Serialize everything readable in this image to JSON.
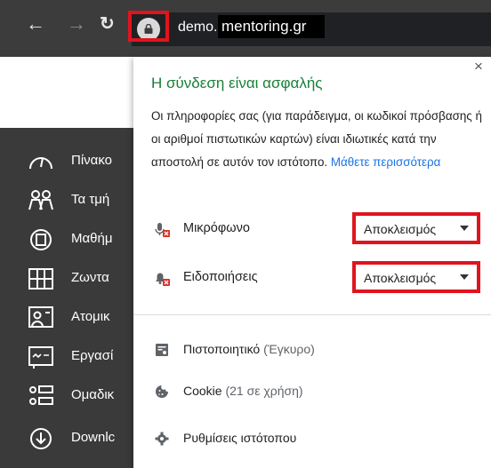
{
  "browser": {
    "url_prefix": "demo.",
    "url_domain": "mentoring.gr",
    "icons": {
      "back": "arrow-left-icon",
      "forward": "arrow-right-icon",
      "reload": "reload-icon",
      "lock": "lock-icon"
    }
  },
  "sidebar": {
    "items": [
      {
        "label": "Πίνακο",
        "icon": "dashboard-icon"
      },
      {
        "label": "Τα τμή",
        "icon": "people-icon"
      },
      {
        "label": "Μαθήμ",
        "icon": "lesson-icon"
      },
      {
        "label": "Ζωντα",
        "icon": "grid-icon"
      },
      {
        "label": "Ατομικ",
        "icon": "person-board-icon"
      },
      {
        "label": "Εργασί",
        "icon": "board-icon"
      },
      {
        "label": "Ομαδικ",
        "icon": "group-list-icon"
      },
      {
        "label": "Downlc",
        "icon": "download-icon"
      }
    ]
  },
  "popup": {
    "title": "Η σύνδεση είναι ασφαλής",
    "description": "Οι πληροφορίες σας (για παράδειγμα, οι κωδικοί πρόσβασης ή οι αριθμοί πιστωτικών καρτών) είναι ιδιωτικές κατά την αποστολή σε αυτόν τον ιστότοπο.",
    "learn_more": "Μάθετε περισσότερα",
    "close_label": "×",
    "permissions": [
      {
        "label": "Μικρόφωνο",
        "value": "Αποκλεισμός",
        "icon": "microphone-blocked-icon"
      },
      {
        "label": "Ειδοποιήσεις",
        "value": "Αποκλεισμός",
        "icon": "bell-blocked-icon"
      }
    ],
    "links": [
      {
        "label": "Πιστοποιητικό",
        "sub": "(Έγκυρο)",
        "icon": "certificate-icon"
      },
      {
        "label": "Cookie",
        "sub": "(21 σε χρήση)",
        "icon": "cookie-icon"
      },
      {
        "label": "Ρυθμίσεις ιστότοπου",
        "sub": "",
        "icon": "gear-icon"
      }
    ]
  },
  "colors": {
    "secure_green": "#188038",
    "link_blue": "#1a73e8",
    "highlight_red": "#e0141e",
    "topbar": "#3c3c3c"
  }
}
